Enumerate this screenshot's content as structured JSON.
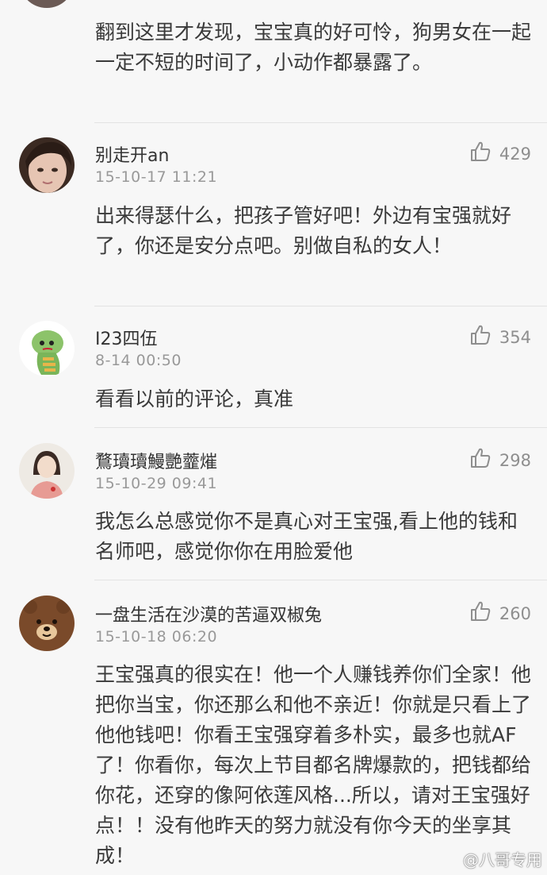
{
  "comments": [
    {
      "text": "翻到这里才发现，宝宝真的好可怜，狗男女在一起一定不短的时间了，小动作都暴露了。"
    },
    {
      "name": "别走开an",
      "time": "15-10-17 11:21",
      "likes": "429",
      "text": "出来得瑟什么，把孩子管好吧！外边有宝强就好了，你还是安分点吧。别做自私的女人！"
    },
    {
      "name": "I23四伍",
      "time": "8-14 00:50",
      "likes": "354",
      "text": "看看以前的评论，真准"
    },
    {
      "name": "鶩瓄瓄鰻艷虀熣",
      "time": "15-10-29 09:41",
      "likes": "298",
      "text": "我怎么总感觉你不是真心对王宝强,看上他的钱和名师吧，感觉你你在用脸爱他"
    },
    {
      "name": "一盘生活在沙漠的苦逼双椒兔",
      "time": "15-10-18 06:20",
      "likes": "260",
      "text": "王宝强真的很实在！他一个人赚钱养你们全家！他把你当宝，你还那么和他不亲近！你就是只看上了他他钱吧！你看王宝强穿着多朴实，最多也就AF了！你看你，每次上节目都名牌爆款的，把钱都给你花，还穿的像阿依莲风格...所以，请对王宝强好点！！没有他昨天的努力就没有你今天的坐享其成！"
    }
  ],
  "watermark": "@八哥专用",
  "colors": {
    "background": "#f7f7f7",
    "name": "#333333",
    "time": "#999999",
    "like": "#8e8e8e",
    "divider": "#e3e3e3"
  },
  "icons": {
    "like": "thumbs-up-icon"
  }
}
